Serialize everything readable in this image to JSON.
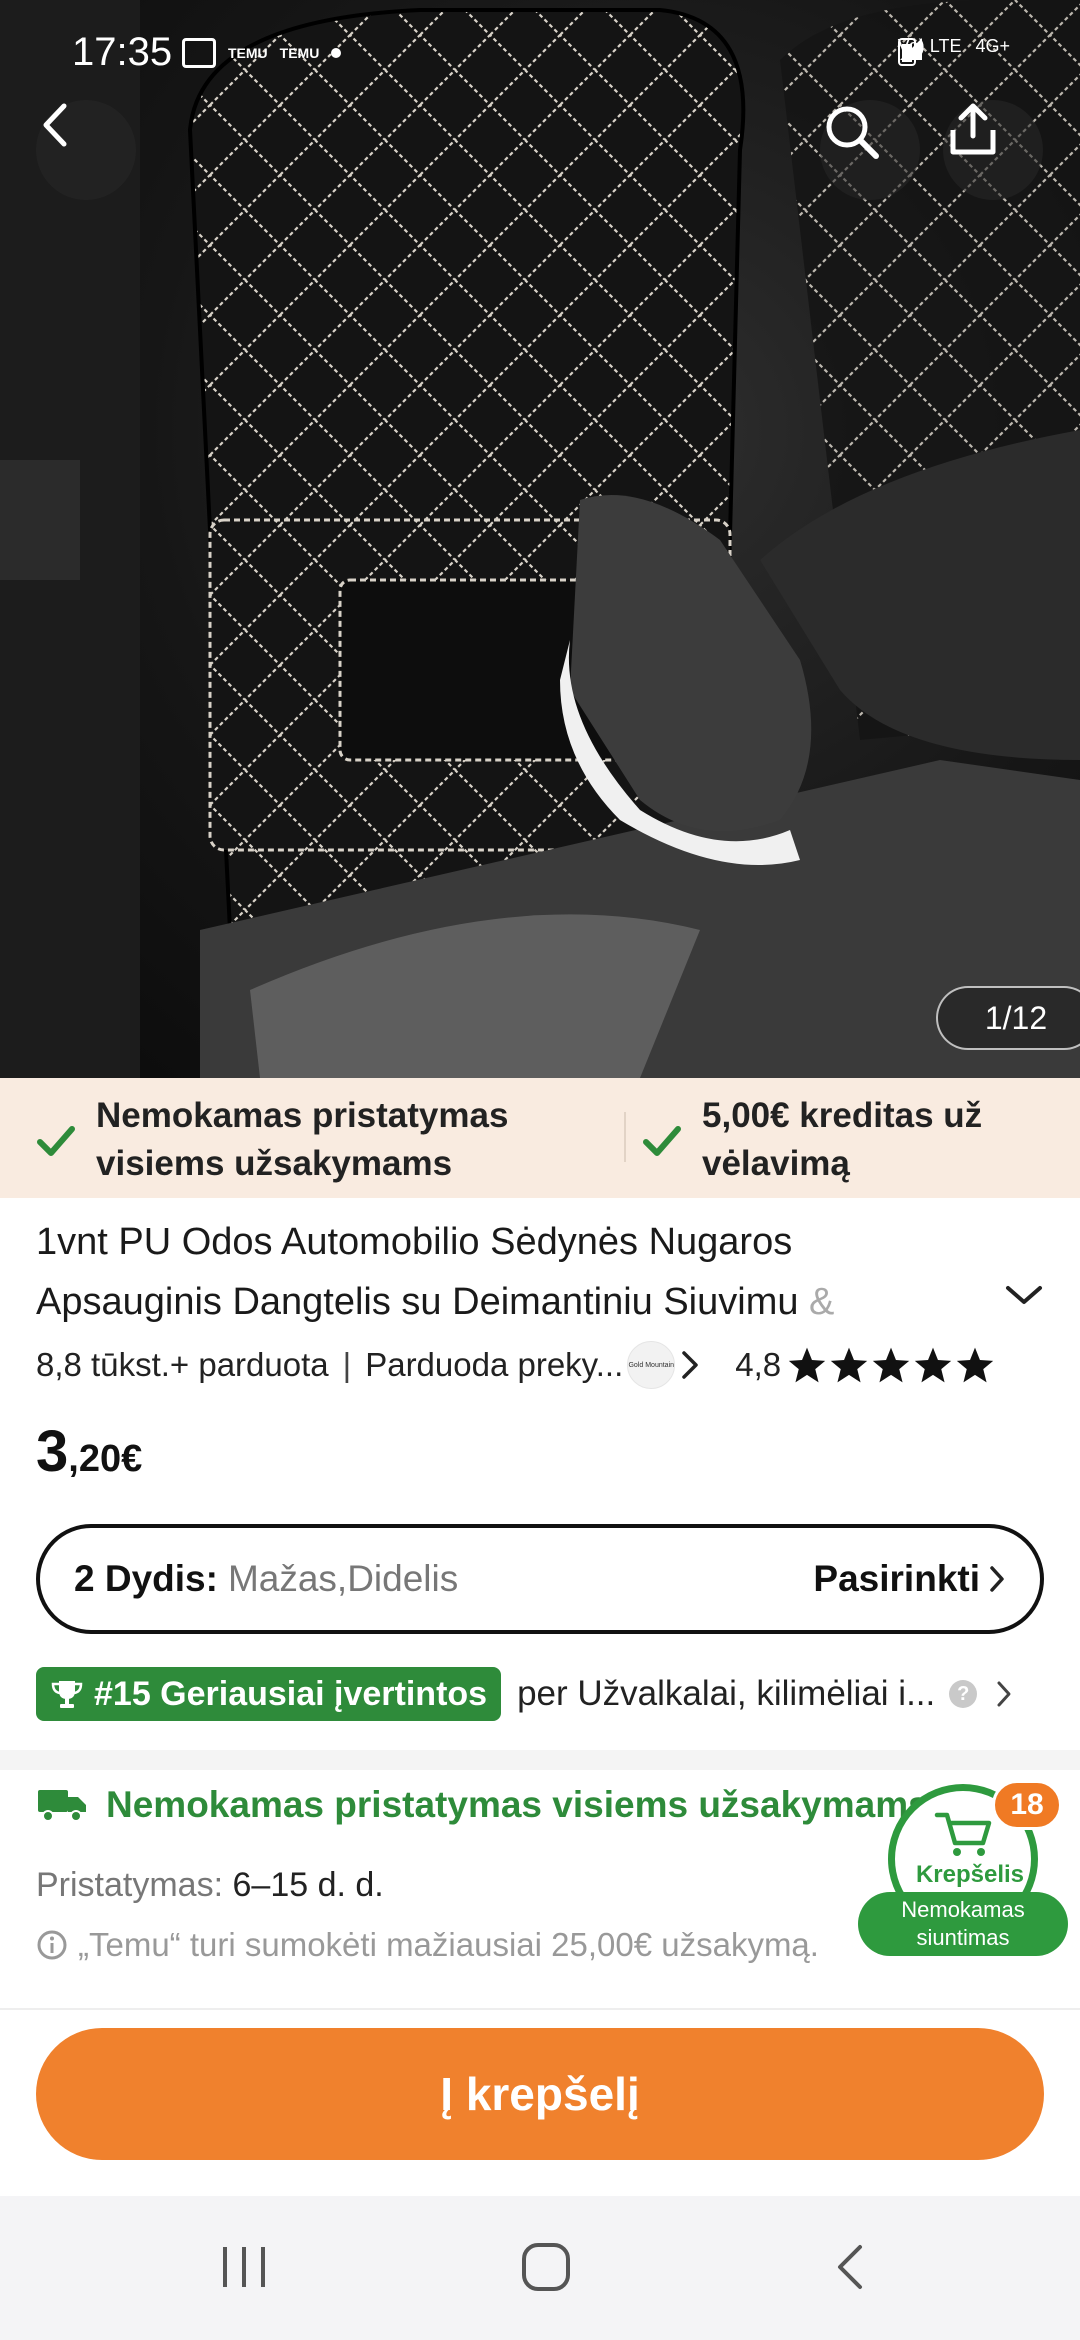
{
  "status_bar": {
    "time": "17:35",
    "notif_small_1": "TEMU",
    "notif_small_2": "TEMU",
    "network": "Vo) LTE",
    "network_type": "4G+"
  },
  "hero": {
    "image_counter": "1/12",
    "icons": [
      "back-icon",
      "search-icon",
      "share-icon"
    ]
  },
  "promo": {
    "item1": "Nemokamas pristatymas visiems užsakymams",
    "item1_line1": "Nemokamas pristatymas",
    "item1_line2": "visiems užsakymams",
    "item2_line1": "5,00€ kreditas už",
    "item2_line2": "vėlavimą"
  },
  "product": {
    "title_line1": "1vnt PU Odos Automobilio Sėdynės Nugaros",
    "title_line2": "Apsauginis Dangtelis su Deimantiniu Siuvimu",
    "title_fade": " &",
    "sold": "8,8 tūkst.+ parduota",
    "seller": "Parduoda preky...",
    "seller_logo_text": "Gold Mountain",
    "rating": "4,8",
    "price_main": "3",
    "price_rest": ",20€"
  },
  "size": {
    "label": "2 Dydis:",
    "value": "Mažas,Didelis",
    "choose": "Pasirinkti"
  },
  "rank": {
    "badge": "#15 Geriausiai įvertintos",
    "text": "per Užvalkalai, kilimėliai i..."
  },
  "shipping": {
    "headline": "Nemokamas pristatymas visiems užsakymams",
    "delivery_label": "Pristatymas:",
    "delivery_value": "6–15 d. d.",
    "note": "„Temu“ turi sumokėti mažiausiai 25,00€ užsakymą."
  },
  "cart_float": {
    "label": "Krepšelis",
    "count": "18",
    "pill_line1": "Nemokamas",
    "pill_line2": "siuntimas"
  },
  "cta": {
    "add_to_cart": "Į krepšelį"
  },
  "colors": {
    "accent": "#f0812d",
    "green": "#2e8b3a",
    "promo_bg": "#f9ebe0"
  }
}
